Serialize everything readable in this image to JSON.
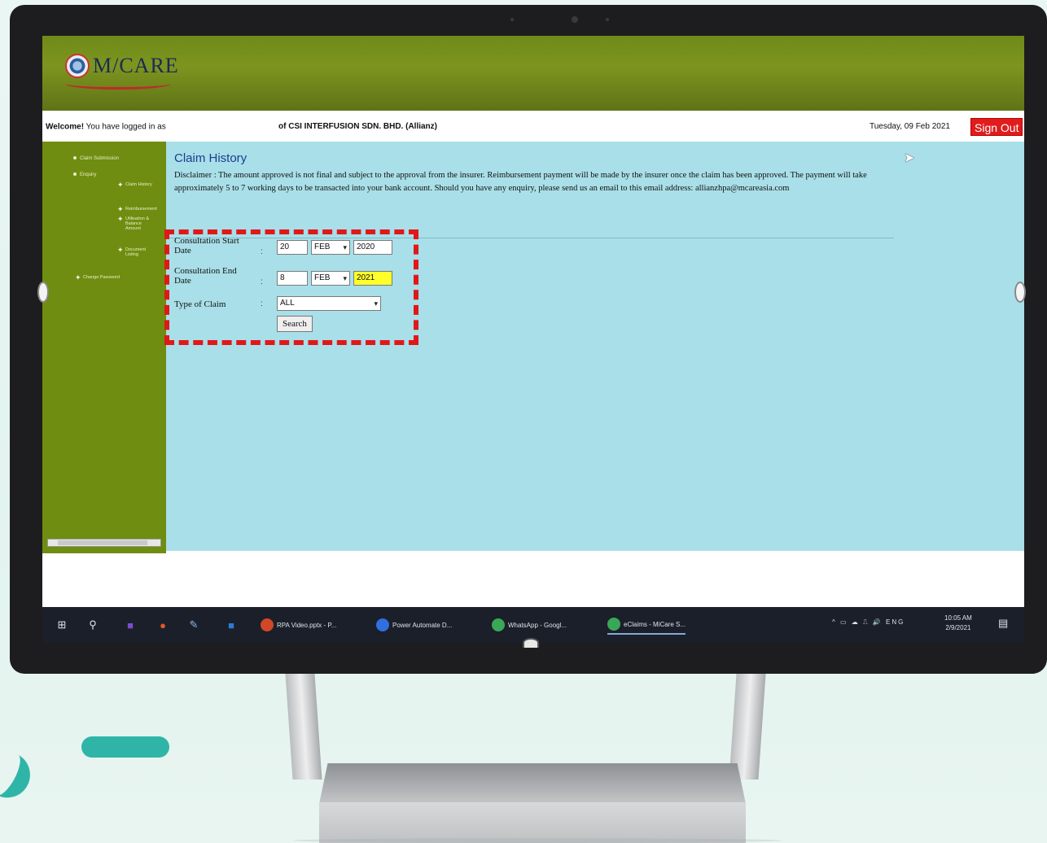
{
  "app": {
    "logo_text": "M/CARE",
    "welcome_bold": "Welcome!",
    "welcome_text": "You have logged in as",
    "company": "of CSI INTERFUSION SDN. BHD. (Allianz)",
    "date": "Tuesday, 09 Feb 2021",
    "signout_label": "Sign Out"
  },
  "nav": {
    "items": [
      "Claim Submission",
      "Enquiry",
      "Change Password"
    ],
    "subitems": [
      "Claim History",
      "Reimbursement",
      "Utilisation & Balance Amount",
      "Document Listing"
    ]
  },
  "page": {
    "title": "Claim History",
    "disclaimer": "Disclaimer : The amount approved is not final and subject to the approval from the insurer. Reimbursement payment will be made by the insurer once the claim has been approved. The payment will take approximately 5 to 7 working days to be transacted into your bank account. Should you have any enquiry, please send us an email to this email address: allianzhpa@mcareasia.com"
  },
  "form": {
    "start_label": "Consultation Start Date",
    "start_day": "20",
    "start_month": "FEB",
    "start_year": "2020",
    "end_label": "Consultation End Date",
    "end_day": "8",
    "end_month": "FEB",
    "end_year": "2021",
    "type_label": "Type of Claim",
    "type_value": "ALL",
    "search_label": "Search",
    "colon": ":"
  },
  "taskbar": {
    "apps": [
      {
        "label": "RPA Video.pptx - P...",
        "color": "#d24726"
      },
      {
        "label": "Power Automate D...",
        "color": "#2f6fe0"
      },
      {
        "label": "WhatsApp - Googl...",
        "color": "#3aa757"
      },
      {
        "label": "eClaims - MiCare S...",
        "color": "#3aa757"
      }
    ],
    "tray": "^  ▭  ☁  ⎍  🔊  ENG",
    "time": "10:05 AM",
    "date": "2/9/2021"
  },
  "colors": {
    "header_green": "#6f8a1a",
    "nav_green": "#6f8d10",
    "content_blue": "#a9dfe8",
    "signout_red": "#e01c1c",
    "highlight_box": "#e01818",
    "accent_teal": "#2fb5a7"
  }
}
